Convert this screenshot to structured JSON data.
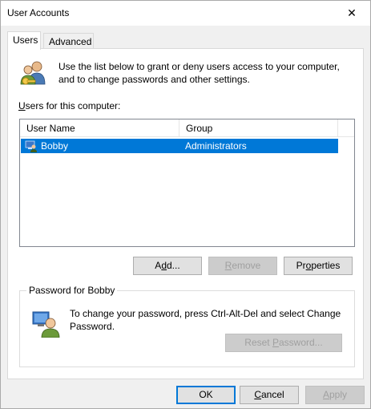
{
  "window": {
    "title": "User Accounts",
    "close_glyph": "✕"
  },
  "tabs": [
    {
      "label": "Users",
      "active": true
    },
    {
      "label": "Advanced",
      "active": false
    }
  ],
  "intro": {
    "text": "Use the list below to grant or deny users access to your computer, and to change passwords and other settings."
  },
  "users_label": {
    "mnemonic": "U",
    "rest": "sers for this computer:"
  },
  "list": {
    "columns": [
      "User Name",
      "Group"
    ],
    "rows": [
      {
        "name": "Bobby",
        "group": "Administrators",
        "selected": true
      }
    ]
  },
  "buttons": {
    "add": {
      "mnemonic": "d",
      "before": "A",
      "after": "d..."
    },
    "remove": {
      "before": "",
      "mnemonic": "R",
      "after": "emove"
    },
    "properties": {
      "before": "Pr",
      "mnemonic": "o",
      "after": "perties"
    }
  },
  "password_group": {
    "label": "Password for Bobby",
    "text": "To change your password, press Ctrl-Alt-Del and select Change Password.",
    "reset": {
      "before": "Reset ",
      "mnemonic": "P",
      "after": "assword..."
    }
  },
  "footer": {
    "ok": "OK",
    "cancel": {
      "before": "",
      "mnemonic": "C",
      "after": "ancel"
    },
    "apply": {
      "before": "",
      "mnemonic": "A",
      "after": "pply"
    }
  },
  "colors": {
    "selection": "#0078d7",
    "accent": "#0078d7"
  },
  "icons": {
    "intro": "users-key-icon",
    "row": "user-computer-icon",
    "password": "user-password-icon",
    "close": "close-icon"
  }
}
